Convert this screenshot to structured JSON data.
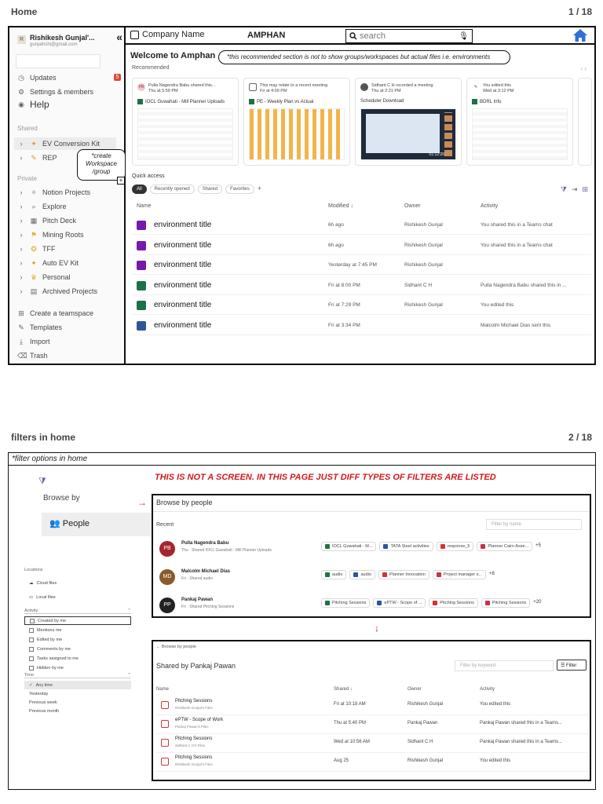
{
  "page1": {
    "title": "Home",
    "page_counter": "1 / 18",
    "sidebar": {
      "user_name": "Rishikesh Gunjal'...",
      "user_email": "gunjalrishi@gmail.com",
      "user_initial": "R",
      "collapse_glyph": "«",
      "updates": "Updates",
      "updates_badge": "5",
      "settings": "Settings & members",
      "help": "Help",
      "shared_label": "Shared",
      "shared_items": [
        "EV Conversion Kit",
        "REP"
      ],
      "note": "*create Workspace /group",
      "private_label": "Private",
      "private_items": [
        "Notion Projects",
        "Explore",
        "Pitch Deck",
        "Mining Roots",
        "TFF",
        "Auto EV Kit",
        "Personal",
        "Archived Projects"
      ],
      "bottom_items": [
        "Create a teamspace",
        "Templates",
        "Import",
        "Trash"
      ]
    },
    "topbar": {
      "company": "Company Name",
      "workspace": "AMPHAN",
      "search_placeholder": "search"
    },
    "welcome": "Welcome to Amphan",
    "note": "*this recommended section is not to show groups/workspaces but actual files i.e. environments",
    "recommended_label": "Recommended",
    "rec_nav": "‹  ›",
    "cards": [
      {
        "header": "Pulla Nagendra Babu shared this...",
        "sub": "Thu at 5:59 PM",
        "avatar": "PB",
        "file": "IOCL Guwahati - Mill Planner Uploads"
      },
      {
        "header": "This may relate to a recent meeting",
        "sub": "Fri at 4:00 PM",
        "avatar": "",
        "file": "PE - Weekly Plan vs Actual"
      },
      {
        "header": "Sidhant C H recorded a meeting",
        "sub": "Thu at 2:21 PM",
        "avatar": "",
        "file": "Scheduler Download"
      },
      {
        "header": "You edited this",
        "sub": "Wed at 3:12 PM",
        "avatar": "",
        "file": "BDRL Info"
      }
    ],
    "video_time": "01:12:20",
    "quick_access": "Quick access",
    "chips": [
      "All",
      "Recently opened",
      "Shared",
      "Favorites"
    ],
    "chip_plus": "+",
    "columns": {
      "name": "Name",
      "modified": "Modified ↓",
      "owner": "Owner",
      "activity": "Activity"
    },
    "rows": [
      {
        "name": "environment title",
        "modified": "6h ago",
        "owner": "Rishikesh Gunjal",
        "activity": "You shared this in a Teams chat",
        "color": "#7719aa"
      },
      {
        "name": "environment title",
        "modified": "6h ago",
        "owner": "Rishikesh Gunjal",
        "activity": "You shared this in a Teams chat",
        "color": "#7719aa"
      },
      {
        "name": "environment title",
        "modified": "Yesterday at 7:45 PM",
        "owner": "Rishikesh Gunjal",
        "activity": "",
        "color": "#7719aa"
      },
      {
        "name": "environment title",
        "modified": "Fri at 8:00 PM",
        "owner": "Sidhant C H",
        "activity": "Pulla Nagendra Babu shared this in ...",
        "color": "#1e7145"
      },
      {
        "name": "environment title",
        "modified": "Fri at 7:29 PM",
        "owner": "Rishikesh Gunjal",
        "activity": "You edited this",
        "color": "#1e7145"
      },
      {
        "name": "environment title",
        "modified": "Fri at 3:34 PM",
        "owner": "",
        "activity": "Malcolm Michael Dias sent this",
        "color": "#2b579a"
      }
    ]
  },
  "page2": {
    "title": "filters  in home",
    "page_counter": "2 / 18",
    "frame_title": "*filter options in home",
    "not_screen": "THIS IS NOT A SCREEN. IN THIS PAGE JUST DIFF TYPES OF FILTERS ARE LISTED",
    "browse_by": "Browse by",
    "people": "People",
    "locations": "Locations",
    "cloud_files": "Cloud files",
    "local_files": "Local files",
    "activity_label": "Activity",
    "activity_items": [
      "Created by me",
      "Mentions me",
      "Edited by me",
      "Comments by me",
      "Tasks assigned to me",
      "Hidden by me"
    ],
    "time_label": "Time",
    "time_items": [
      "Any time",
      "Yesterday",
      "Previous week",
      "Previous month"
    ],
    "browse_people": {
      "title": "Browse by people",
      "recent": "Recent",
      "filter_placeholder": "Filter by name",
      "people": [
        {
          "initials": "PB",
          "name": "Pulla Nagendra Babu",
          "sub": "Thu · Shared IOCL Guwahati - Mill Planner Uploads",
          "files": [
            "IOCL Guwahati - M...",
            "TATA Steel activities",
            "response_5",
            "Planner Cairn Asse..."
          ],
          "more": "+5",
          "color": "#a4262c"
        },
        {
          "initials": "MD",
          "name": "Malcolm Michael Dias",
          "sub": "Fri · Shared audio",
          "files": [
            "audio",
            "audio",
            "Planner Innovation",
            "Project manager s..."
          ],
          "more": "+8",
          "color": "#8a5a2b"
        },
        {
          "initials": "PP",
          "name": "Pankaj Pawan",
          "sub": "Fri · Shared Pitching Sessions",
          "files": [
            "Pitching Sessions",
            "ePTW - Scope of ...",
            "Pitching Sessions",
            "Pitching Sessions"
          ],
          "more": "+20",
          "color": "#222222"
        }
      ]
    },
    "person_page": {
      "back": "← Browse by people",
      "title": "Shared by Pankaj Pawan",
      "keyword_placeholder": "Filter by keyword",
      "filter_btn": "Filter",
      "columns": {
        "name": "Name",
        "shared": "Shared ↓",
        "owner": "Owner",
        "activity": "Activity"
      },
      "rows": [
        {
          "name": "Pitching Sessions",
          "sub": "Rishikesh Gunjal's Files",
          "shared": "Fri at 10:18 AM",
          "owner": "Rishikesh Gunjal",
          "activity": "You edited this"
        },
        {
          "name": "ePTW - Scope of Work",
          "sub": "Pankaj Pawan's Files",
          "shared": "Thu at 5:40 PM",
          "owner": "Pankaj Pawan",
          "activity": "Pankaj Pawan shared this in a Teams..."
        },
        {
          "name": "Pitching Sessions",
          "sub": "Sidhant C H's Files",
          "shared": "Wed at 10:56 AM",
          "owner": "Sidhant C H",
          "activity": "Pankaj Pawan shared this in a Teams..."
        },
        {
          "name": "Pitching Sessions",
          "sub": "Rishikesh Gunjal's Files",
          "shared": "Aug 25",
          "owner": "Rishikesh Gunjal",
          "activity": "You edited this"
        }
      ]
    }
  },
  "colors": {
    "accent": "#6264a7",
    "red_note": "#d21b1b",
    "home_icon": "#2f6fd6",
    "badge": "#d9493b"
  }
}
